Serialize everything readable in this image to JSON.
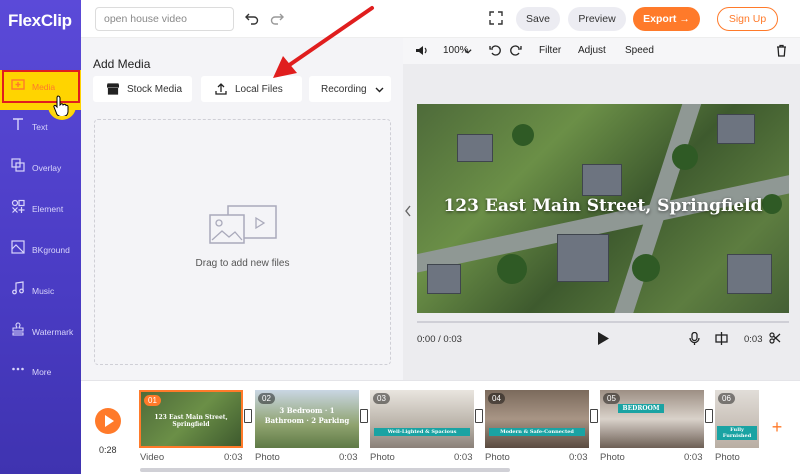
{
  "app": {
    "logo_text": "FlexClip"
  },
  "sidebar": {
    "items": [
      {
        "label": "Media",
        "icon": "media-icon"
      },
      {
        "label": "Text",
        "icon": "text-icon"
      },
      {
        "label": "Overlay",
        "icon": "overlay-icon"
      },
      {
        "label": "Element",
        "icon": "element-icon"
      },
      {
        "label": "BKground",
        "icon": "background-icon"
      },
      {
        "label": "Music",
        "icon": "music-icon"
      },
      {
        "label": "Watermark",
        "icon": "watermark-icon"
      },
      {
        "label": "More",
        "icon": "more-icon"
      }
    ]
  },
  "topbar": {
    "project_name": "open house video",
    "save_label": "Save",
    "preview_label": "Preview",
    "export_label": "Export →",
    "signup_label": "Sign Up"
  },
  "media_panel": {
    "title": "Add Media",
    "stock_media_label": "Stock Media",
    "local_files_label": "Local Files",
    "recording_label": "Recording",
    "dropzone_text": "Drag to add new files"
  },
  "preview_toolbar": {
    "zoom": "100%",
    "filter_label": "Filter",
    "adjust_label": "Adjust",
    "speed_label": "Speed"
  },
  "video": {
    "title_text": "123 East Main Street, Springfield",
    "current_time": "0:00 / 0:03",
    "duration": "0:03"
  },
  "timeline": {
    "total_time": "0:28",
    "clips": [
      {
        "num": "01",
        "text": "123 East Main Street, Springfield",
        "type": "Video",
        "duration": "0:03"
      },
      {
        "num": "02",
        "text": "3 Bedroom · 1 Bathroom · 2 Parking",
        "type": "Photo",
        "duration": "0:03"
      },
      {
        "num": "03",
        "text": "Well-Lighted & Spacious",
        "type": "Photo",
        "duration": "0:03"
      },
      {
        "num": "04",
        "text": "Modern & Safe-Connected",
        "type": "Photo",
        "duration": "0:03"
      },
      {
        "num": "05",
        "text": "BEDROOM",
        "type": "Photo",
        "duration": "0:03"
      },
      {
        "num": "06",
        "text": "Fully Furnished",
        "type": "Photo",
        "duration": ""
      }
    ]
  },
  "colors": {
    "accent": "#ff7a2a",
    "sidebar": "#4a3cc4",
    "highlight": "#ffd400",
    "annotation": "#e01e1e"
  }
}
